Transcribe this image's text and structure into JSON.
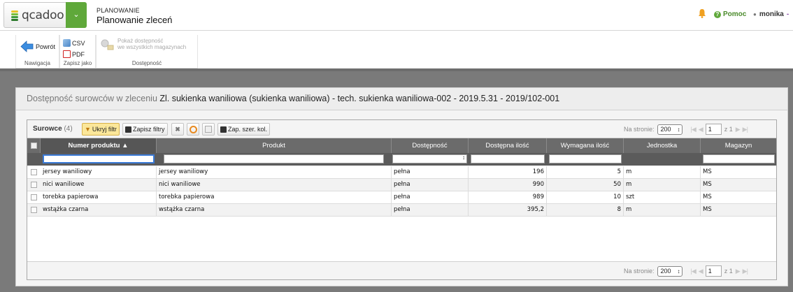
{
  "app": {
    "logo_text": "qcadoo",
    "section": "PLANOWANIE",
    "page_title": "Planowanie zleceń",
    "help_label": "Pomoc",
    "user_name": "monika"
  },
  "ribbon": {
    "back_label": "Powrót",
    "nav_group": "Nawigacja",
    "csv_label": "CSV",
    "pdf_label": "PDF",
    "save_group": "Zapisz jako",
    "avail_line1": "Pokaż dostępność",
    "avail_line2": "we wszystkich magazynach",
    "avail_group": "Dostępność"
  },
  "panel": {
    "header_label": "Dostępność surowców w zleceniu",
    "header_value": "Zl. sukienka waniliowa (sukienka waniliowa) - tech. sukienka waniliowa-002 - 2019.5.31 - 2019/102-001"
  },
  "grid": {
    "title": "Surowce",
    "count": "(4)",
    "hide_filter": "Ukryj filtr",
    "save_filters": "Zapisz filtry",
    "save_widths": "Zap. szer. kol.",
    "per_page_label": "Na stronie:",
    "per_page_value": "200",
    "page_value": "1",
    "page_of": "z 1",
    "columns": [
      "Numer produktu",
      "Produkt",
      "Dostępność",
      "Dostępna ilość",
      "Wymagana ilość",
      "Jednostka",
      "Magazyn"
    ],
    "sort_indicator": "▲",
    "rows": [
      {
        "number": "jersey waniliowy",
        "product": "jersey waniliowy",
        "availability": "pełna",
        "available": "196",
        "required": "5",
        "unit": "m",
        "warehouse": "MS"
      },
      {
        "number": "nici waniliowe",
        "product": "nici waniliowe",
        "availability": "pełna",
        "available": "990",
        "required": "50",
        "unit": "m",
        "warehouse": "MS"
      },
      {
        "number": "torebka papierowa",
        "product": "torebka papierowa",
        "availability": "pełna",
        "available": "989",
        "required": "10",
        "unit": "szt",
        "warehouse": "MS"
      },
      {
        "number": "wstążka czarna",
        "product": "wstążka czarna",
        "availability": "pełna",
        "available": "395,2",
        "required": "8",
        "unit": "m",
        "warehouse": "MS"
      }
    ]
  },
  "colors": {
    "brand_green": "#5fa83a",
    "header_gray": "#6b6b6b",
    "active_button": "#fbe79a"
  }
}
